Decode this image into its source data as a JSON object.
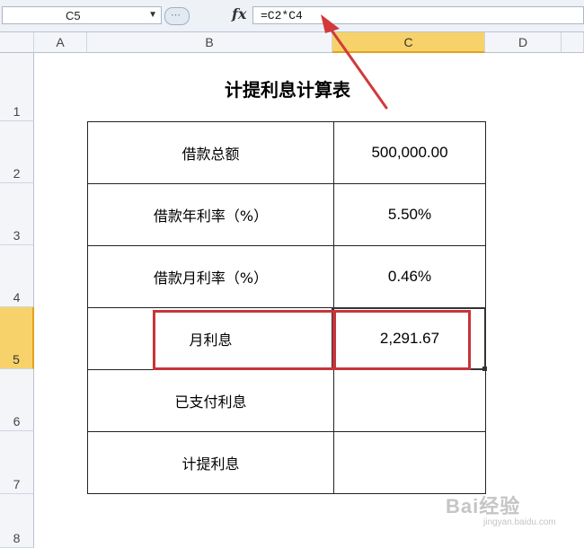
{
  "formula_bar": {
    "name_box": "C5",
    "fx_label": "fx",
    "formula": "=C2*C4"
  },
  "columns": [
    "A",
    "B",
    "C",
    "D"
  ],
  "rows": [
    "1",
    "2",
    "3",
    "4",
    "5",
    "6",
    "7",
    "8"
  ],
  "selected_cell": {
    "column": "C",
    "row": "5"
  },
  "sheet": {
    "title": "计提利息计算表",
    "table": [
      {
        "label": "借款总额",
        "value": "500,000.00"
      },
      {
        "label": "借款年利率（%）",
        "value": "5.50%"
      },
      {
        "label": "借款月利率（%）",
        "value": "0.46%"
      },
      {
        "label": "月利息",
        "value": "2,291.67"
      },
      {
        "label": "已支付利息",
        "value": ""
      },
      {
        "label": "计提利息",
        "value": ""
      }
    ]
  },
  "annotation": {
    "color": "#d23a3a"
  },
  "watermark": {
    "brand": "Bai经验",
    "url": "jingyan.baidu.com"
  }
}
